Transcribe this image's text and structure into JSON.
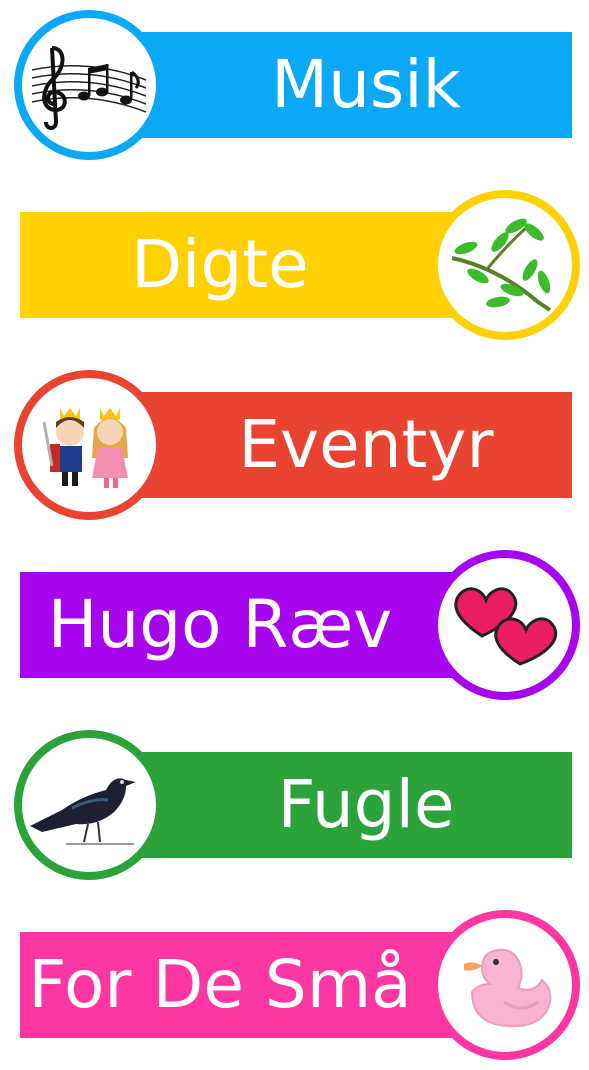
{
  "categories": [
    {
      "label": "Musik",
      "color": "#0aa8f5",
      "icon": "music-notes-icon",
      "icon_side": "left"
    },
    {
      "label": "Digte",
      "color": "#ffd104",
      "icon": "leaf-branch-icon",
      "icon_side": "right"
    },
    {
      "label": "Eventyr",
      "color": "#e94432",
      "icon": "prince-princess-icon",
      "icon_side": "left"
    },
    {
      "label": "Hugo Ræv",
      "color": "#a705ee",
      "icon": "hearts-icon",
      "icon_side": "right"
    },
    {
      "label": "Fugle",
      "color": "#2ba23a",
      "icon": "blackbird-icon",
      "icon_side": "left"
    },
    {
      "label": "For De Små",
      "color": "#fc36a3",
      "icon": "rubber-duck-icon",
      "icon_side": "right"
    }
  ]
}
